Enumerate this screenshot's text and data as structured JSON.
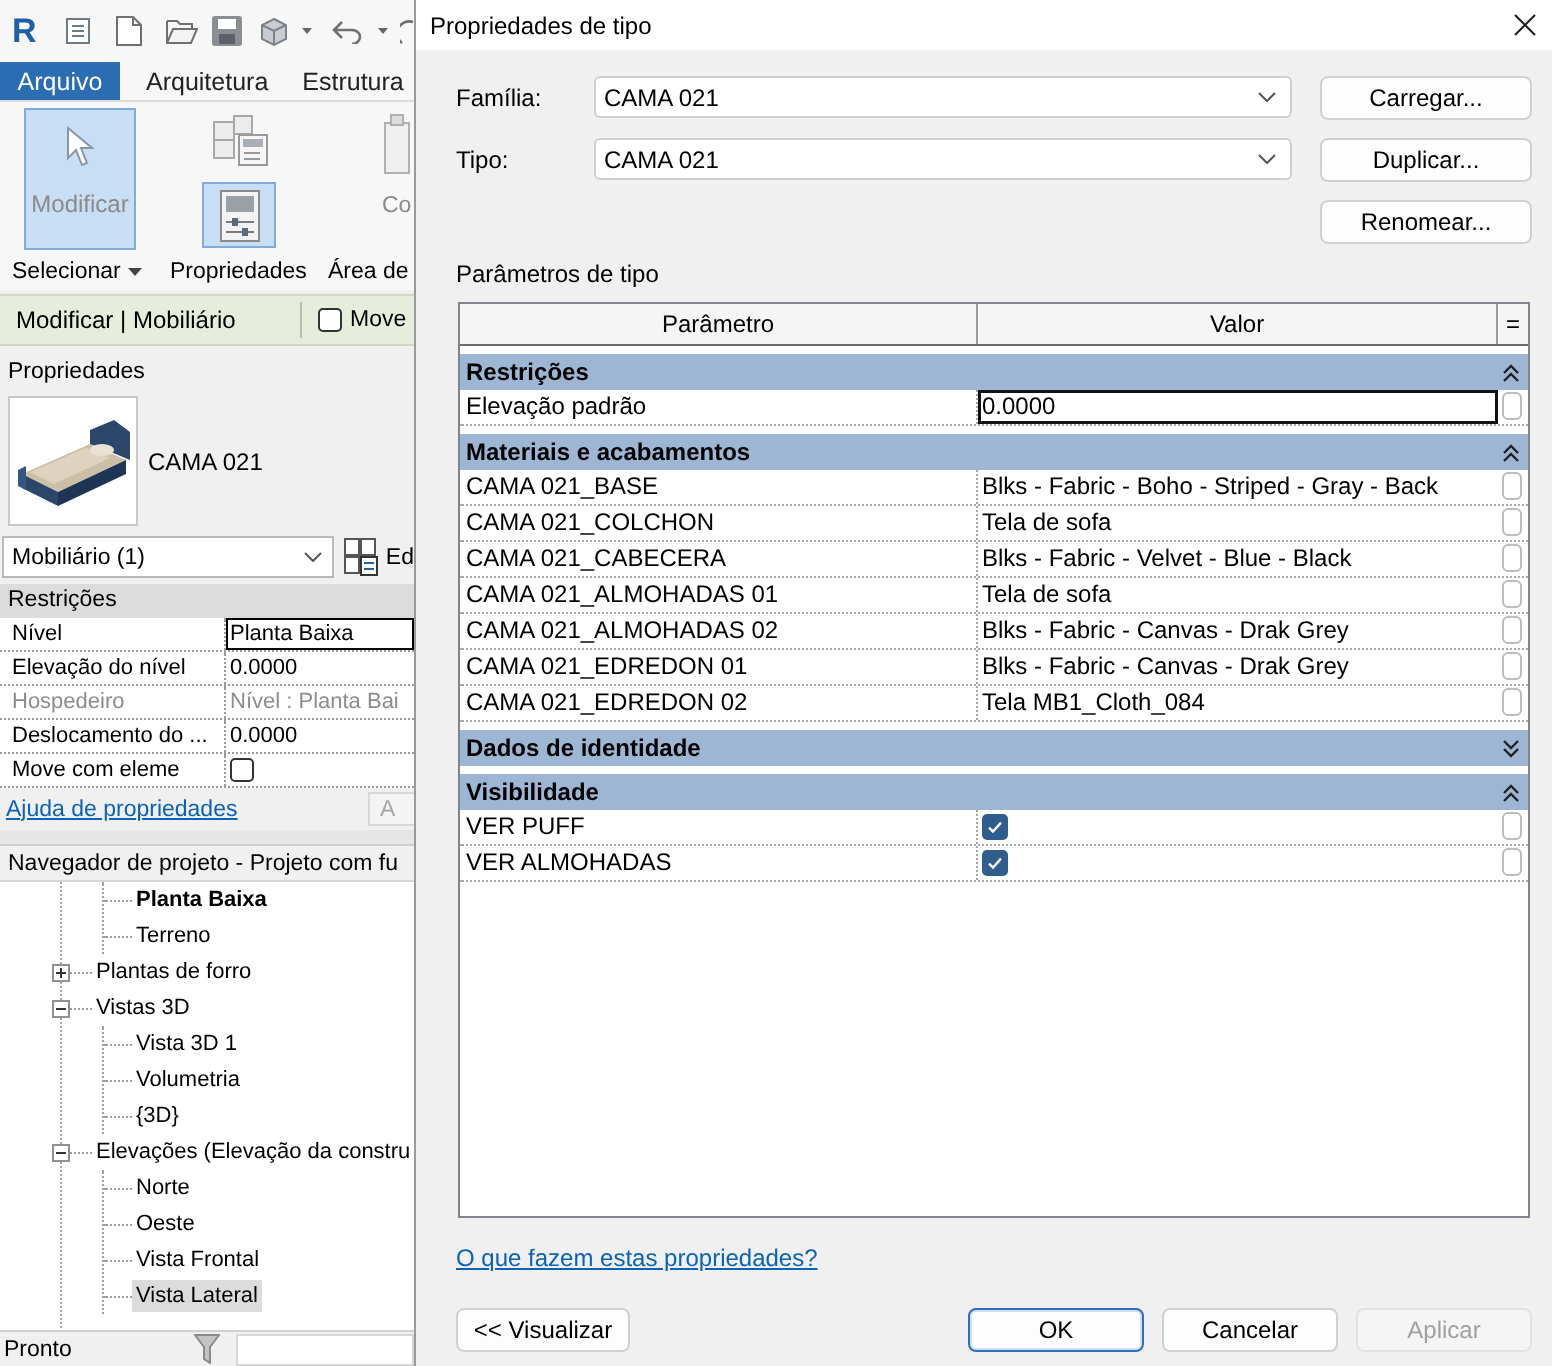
{
  "app": {
    "quick_access": {
      "logo": "R"
    },
    "file_tab": "Arquivo",
    "ribbon_tabs": [
      "Arquitetura",
      "Estrutura"
    ],
    "ribbon_tools": [
      {
        "kind": "cursor",
        "label": "Modificar",
        "selected": true
      },
      {
        "kind": "properties",
        "selected": true
      },
      {
        "kind": "clipboard",
        "label": "Co",
        "selected": false
      }
    ],
    "ribbon_panels": [
      {
        "label": "Selecionar",
        "dropdown": true
      },
      {
        "label": "Propriedades",
        "dropdown": false
      },
      {
        "label": "Área de",
        "dropdown": false
      }
    ],
    "context_bar": {
      "title": "Modificar | Mobiliário",
      "option": {
        "label": "Move",
        "checked": false
      }
    },
    "properties": {
      "title": "Propriedades",
      "type_name": "CAMA 021",
      "category": "Mobiliário (1)",
      "edit_type": "Ed",
      "group": "Restrições",
      "rows": [
        {
          "name": "Nível",
          "kind": "text",
          "value": "Planta Baixa",
          "selected": true,
          "disabled": false
        },
        {
          "name": "Elevação do nível",
          "kind": "text",
          "value": "0.0000",
          "selected": false,
          "disabled": false
        },
        {
          "name": "Hospedeiro",
          "kind": "text",
          "value": "Nível : Planta Bai",
          "selected": false,
          "disabled": true
        },
        {
          "name": "Deslocamento do ...",
          "kind": "text",
          "value": "0.0000",
          "selected": false,
          "disabled": false
        },
        {
          "name": "Move com eleme",
          "kind": "checkbox",
          "checked": false,
          "selected": false,
          "disabled": false
        }
      ],
      "help_link": "Ajuda de propriedades",
      "apply": "A"
    },
    "project_browser": {
      "title": "Navegador de projeto - Projeto com fu",
      "tree": [
        {
          "children": [
            {
              "label": "Planta Baixa",
              "current": true,
              "selected": false
            },
            {
              "label": "Terreno",
              "current": false,
              "selected": false
            }
          ]
        },
        {
          "label": "Plantas de forro",
          "expanded": false,
          "selected": false
        },
        {
          "label": "Vistas 3D",
          "expanded": true,
          "selected": false,
          "children": [
            {
              "label": "Vista 3D 1",
              "current": false,
              "selected": false
            },
            {
              "label": "Volumetria",
              "current": false,
              "selected": false
            },
            {
              "label": "{3D}",
              "current": false,
              "selected": false
            }
          ]
        },
        {
          "label": "Elevações (Elevação da constru",
          "expanded": true,
          "selected": false,
          "children": [
            {
              "label": "Norte",
              "current": false,
              "selected": false
            },
            {
              "label": "Oeste",
              "current": false,
              "selected": false
            },
            {
              "label": "Vista Frontal",
              "current": false,
              "selected": false
            },
            {
              "label": "Vista Lateral",
              "current": false,
              "selected": true
            }
          ]
        }
      ]
    },
    "status_bar": {
      "text": "Pronto"
    }
  },
  "dialog": {
    "title": "Propriedades de tipo",
    "fields": [
      {
        "label": "Família:",
        "value": "CAMA 021"
      },
      {
        "label": "Tipo:",
        "value": "CAMA 021"
      }
    ],
    "side_buttons": [
      "Carregar...",
      "Duplicar...",
      "Renomear..."
    ],
    "parameters_label": "Parâmetros de tipo",
    "table": {
      "columns": [
        "Parâmetro",
        "Valor",
        "="
      ],
      "groups": [
        {
          "name": "Restrições",
          "expanded": true,
          "rows": [
            {
              "name": "Elevação padrão",
              "kind": "text",
              "value": "0.0000",
              "selected": true
            }
          ]
        },
        {
          "name": "Materiais e acabamentos",
          "expanded": true,
          "rows": [
            {
              "name": "CAMA 021_BASE",
              "kind": "text",
              "value": "Blks - Fabric - Boho - Striped - Gray - Back",
              "selected": false
            },
            {
              "name": "CAMA 021_COLCHON",
              "kind": "text",
              "value": "Tela de sofa",
              "selected": false
            },
            {
              "name": "CAMA 021_CABECERA",
              "kind": "text",
              "value": "Blks - Fabric - Velvet - Blue - Black",
              "selected": false
            },
            {
              "name": "CAMA 021_ALMOHADAS 01",
              "kind": "text",
              "value": "Tela de sofa",
              "selected": false
            },
            {
              "name": "CAMA 021_ALMOHADAS 02",
              "kind": "text",
              "value": "Blks - Fabric - Canvas - Drak Grey",
              "selected": false
            },
            {
              "name": "CAMA 021_EDREDON 01",
              "kind": "text",
              "value": "Blks - Fabric - Canvas - Drak Grey",
              "selected": false
            },
            {
              "name": "CAMA 021_EDREDON 02",
              "kind": "text",
              "value": "Tela MB1_Cloth_084",
              "selected": false
            }
          ]
        },
        {
          "name": "Dados de identidade",
          "expanded": false
        },
        {
          "name": "Visibilidade",
          "expanded": true,
          "rows": [
            {
              "name": "VER PUFF",
              "kind": "checkbox",
              "checked": true,
              "selected": false
            },
            {
              "name": "VER ALMOHADAS",
              "kind": "checkbox",
              "checked": true,
              "selected": false
            }
          ]
        }
      ]
    },
    "help_link": "O que fazem estas propriedades?",
    "buttons": [
      {
        "label": "<< Visualizar",
        "default": false,
        "disabled": false
      },
      {
        "label": "OK",
        "default": true,
        "disabled": false
      },
      {
        "label": "Cancelar",
        "default": false,
        "disabled": false
      },
      {
        "label": "Aplicar",
        "default": false,
        "disabled": true
      }
    ]
  }
}
